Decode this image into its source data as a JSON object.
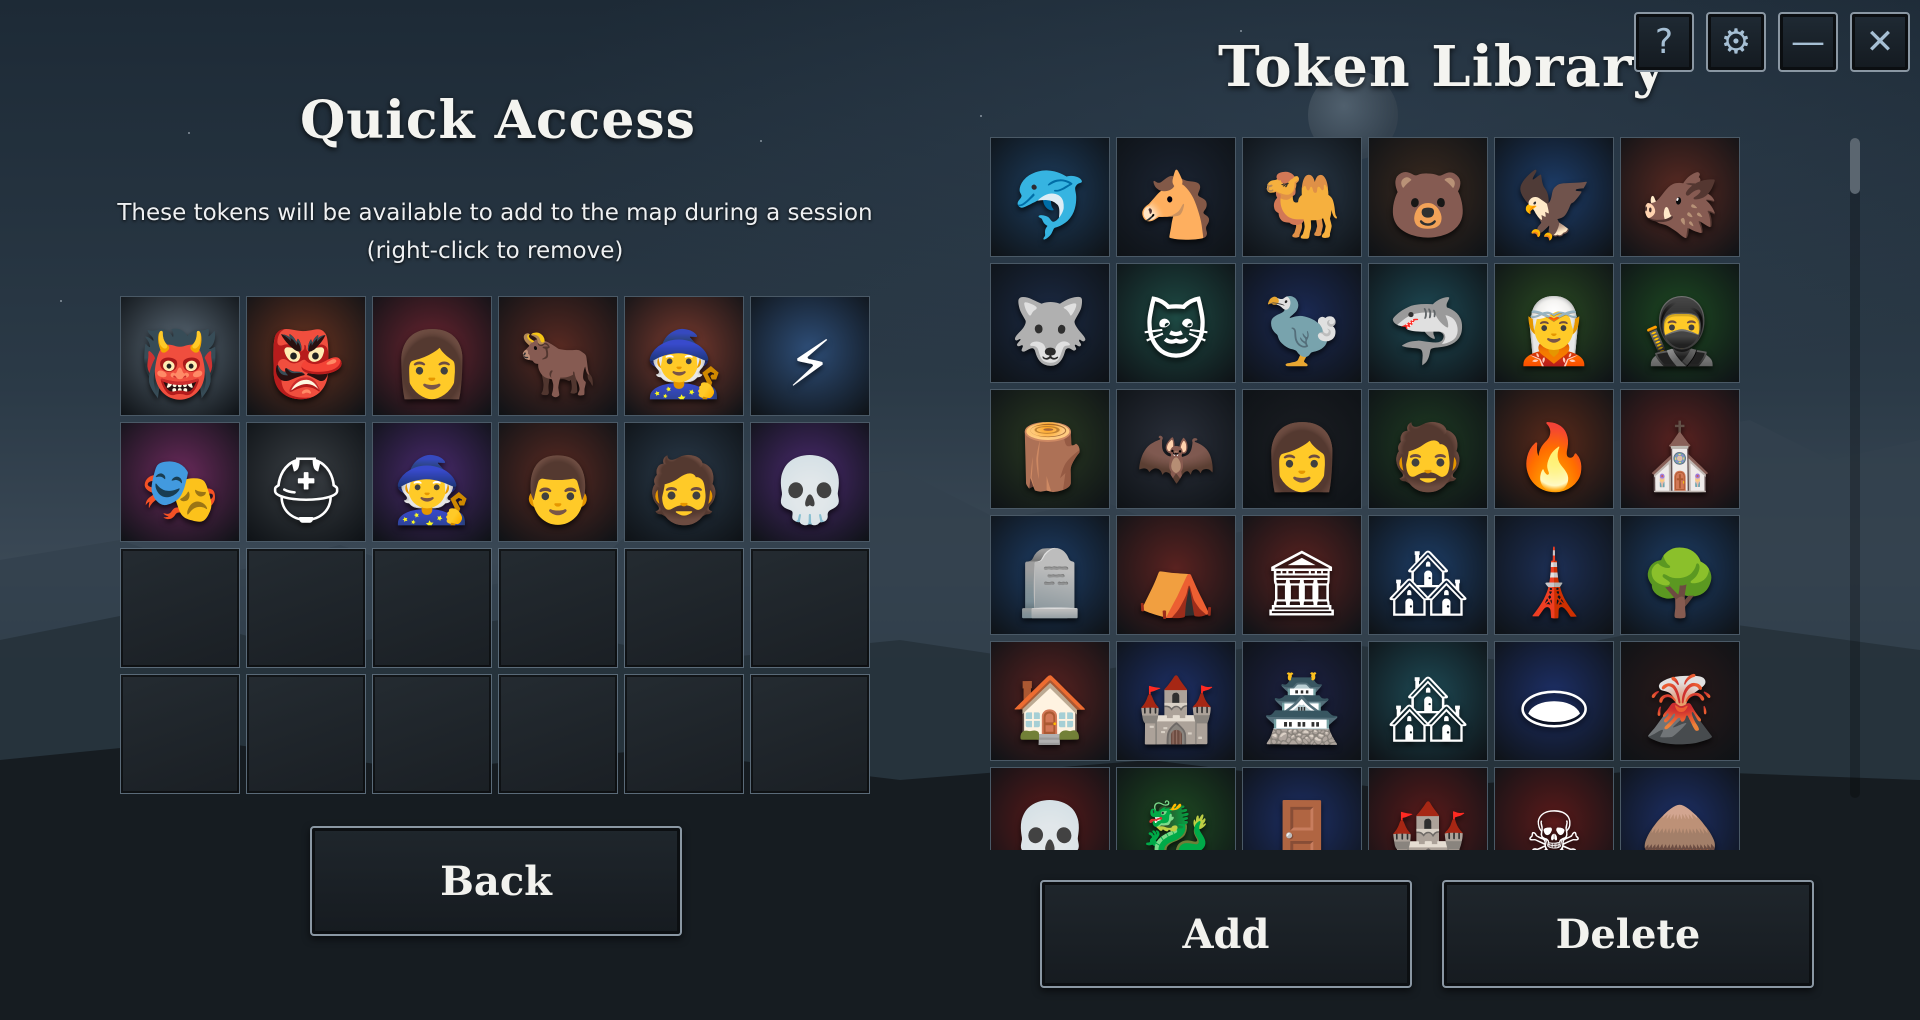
{
  "quick_access": {
    "title": "Quick Access",
    "description": "These tokens will be available to add to the map during a session (right-click to remove)",
    "tokens": [
      {
        "icon": "blue-hooded-orc-portrait-icon",
        "bg": "#5c6b78",
        "glyph": "👹"
      },
      {
        "icon": "red-demon-warrior-portrait-icon",
        "bg": "#6a3320",
        "glyph": "👺"
      },
      {
        "icon": "horned-woman-portrait-icon",
        "bg": "#6b2430",
        "glyph": "👩"
      },
      {
        "icon": "minotaur-portrait-icon",
        "bg": "#5a2a22",
        "glyph": "🐂"
      },
      {
        "icon": "old-wizard-hat-portrait-icon",
        "bg": "#7a3a2e",
        "glyph": "🧙"
      },
      {
        "icon": "zeus-god-portrait-icon",
        "bg": "#2e4e78",
        "glyph": "⚡"
      },
      {
        "icon": "masked-woman-portrait-icon",
        "bg": "#6b2a5c",
        "glyph": "🎭"
      },
      {
        "icon": "armored-knight-helmet-icon",
        "bg": "#3a3f44",
        "glyph": "⛑"
      },
      {
        "icon": "old-wizard-purple-portrait-icon",
        "bg": "#4a2a6e",
        "glyph": "🧙"
      },
      {
        "icon": "man-portrait-icon",
        "bg": "#5a2a22",
        "glyph": "👨"
      },
      {
        "icon": "long-haired-man-portrait-icon",
        "bg": "#2a3a4a",
        "glyph": "🧔"
      },
      {
        "icon": "skull-spiked-portrait-icon",
        "bg": "#4a2a6e",
        "glyph": "💀"
      }
    ],
    "empty_slots": 12
  },
  "library": {
    "title": "Token Library",
    "tokens": [
      {
        "icon": "dolphin-icon",
        "bg": "#1d3d5e",
        "glyph": "🐬"
      },
      {
        "icon": "armored-horse-icon",
        "bg": "#1b2433",
        "glyph": "🐴"
      },
      {
        "icon": "camel-icon",
        "bg": "#2a3a4a",
        "glyph": "🐫"
      },
      {
        "icon": "bear-icon",
        "bg": "#3b2a1f",
        "glyph": "🐻"
      },
      {
        "icon": "eagle-icon",
        "bg": "#1d3d6a",
        "glyph": "🦅"
      },
      {
        "icon": "boar-icon",
        "bg": "#5a2a22",
        "glyph": "🐗"
      },
      {
        "icon": "wolf-icon",
        "bg": "#1b2a44",
        "glyph": "🐺"
      },
      {
        "icon": "wildcat-icon",
        "bg": "#1e4a44",
        "glyph": "🐱"
      },
      {
        "icon": "vulture-icon",
        "bg": "#1b2a55",
        "glyph": "🦤"
      },
      {
        "icon": "shark-icon",
        "bg": "#1e4a55",
        "glyph": "🦈"
      },
      {
        "icon": "hooded-ranger-icon",
        "bg": "#2a4a22",
        "glyph": "🧝"
      },
      {
        "icon": "hooded-assassin-icon",
        "bg": "#1e4a22",
        "glyph": "🥷"
      },
      {
        "icon": "wooden-barricade-icon",
        "bg": "#2a3a22",
        "glyph": "🪵"
      },
      {
        "icon": "bat-icon",
        "bg": "#2a2f3a",
        "glyph": "🦇"
      },
      {
        "icon": "blindfolded-woman-icon",
        "bg": "#1a1d22",
        "glyph": "👩"
      },
      {
        "icon": "bald-bearded-man-icon",
        "bg": "#1e3a22",
        "glyph": "🧔"
      },
      {
        "icon": "campfire-shrine-icon",
        "bg": "#5a2a1a",
        "glyph": "🔥"
      },
      {
        "icon": "chapel-icon",
        "bg": "#5a2220",
        "glyph": "⛪"
      },
      {
        "icon": "graveyard-hill-icon",
        "bg": "#1d3d66",
        "glyph": "🪦"
      },
      {
        "icon": "tent-camp-icon",
        "bg": "#5a2220",
        "glyph": "⛺"
      },
      {
        "icon": "ruined-arch-icon",
        "bg": "#5a2220",
        "glyph": "🏛"
      },
      {
        "icon": "fortified-village-icon",
        "bg": "#1d3d66",
        "glyph": "🏘"
      },
      {
        "icon": "watchtower-icon",
        "bg": "#1d2f55",
        "glyph": "🗼"
      },
      {
        "icon": "burrow-mound-icon",
        "bg": "#1d3d66",
        "glyph": "🌳"
      },
      {
        "icon": "cottage-icon",
        "bg": "#5a2220",
        "glyph": "🏠"
      },
      {
        "icon": "wizard-tower-icon",
        "bg": "#1d2f66",
        "glyph": "🏰"
      },
      {
        "icon": "castle-icon",
        "bg": "#1d2244",
        "glyph": "🏯"
      },
      {
        "icon": "town-icon",
        "bg": "#1e4a55",
        "glyph": "🏘"
      },
      {
        "icon": "cave-entrance-icon",
        "bg": "#1d2f66",
        "glyph": "🕳"
      },
      {
        "icon": "lava-pit-icon",
        "bg": "#2a1a1a",
        "glyph": "🌋"
      },
      {
        "icon": "skull-lair-icon",
        "bg": "#5a1a1a",
        "glyph": "💀"
      },
      {
        "icon": "dragon-nest-icon",
        "bg": "#1e4a22",
        "glyph": "🐉"
      },
      {
        "icon": "portal-gate-icon",
        "bg": "#1d2f66",
        "glyph": "🚪"
      },
      {
        "icon": "dark-fortress-icon",
        "bg": "#5a1a1a",
        "glyph": "🏰"
      },
      {
        "icon": "necromancer-throne-icon",
        "bg": "#5a1a1a",
        "glyph": "☠"
      },
      {
        "icon": "spiked-hut-icon",
        "bg": "#1d2f66",
        "glyph": "🛖"
      }
    ]
  },
  "buttons": {
    "back": "Back",
    "add": "Add",
    "delete": "Delete"
  },
  "window_controls": {
    "help": "?",
    "settings": "⚙",
    "minimize": "—",
    "close": "✕"
  }
}
